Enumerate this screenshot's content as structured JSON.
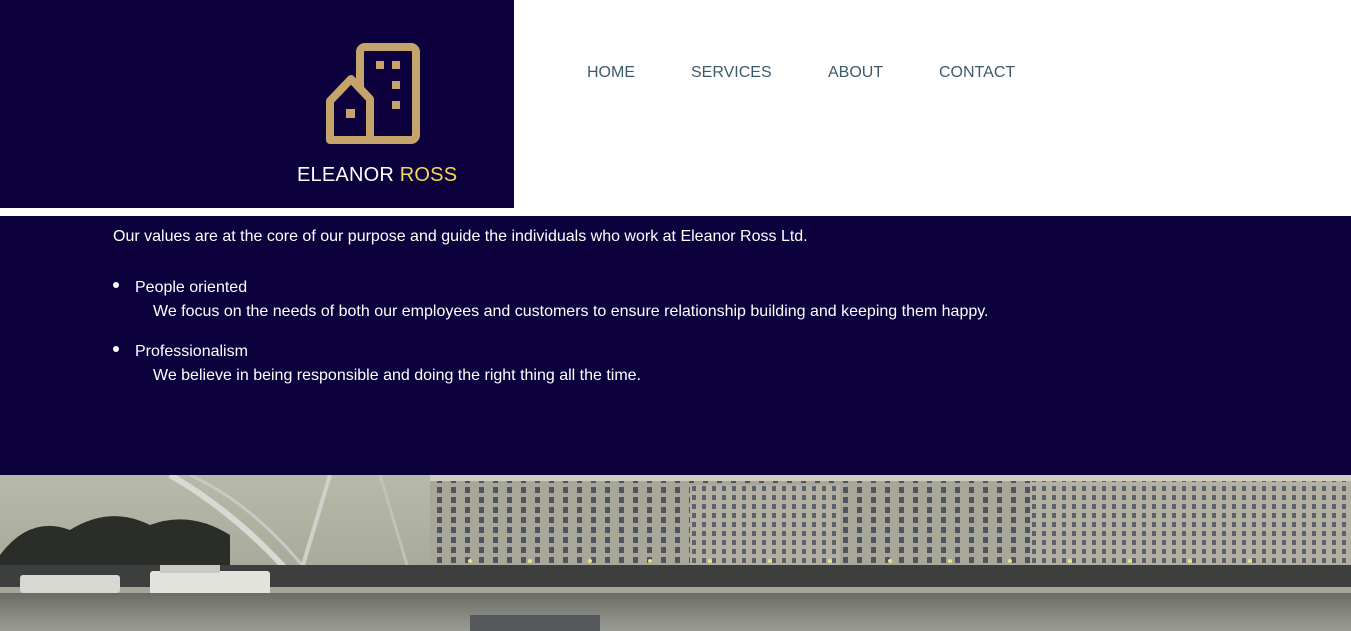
{
  "header": {
    "brand": {
      "first": "ELEANOR",
      "last": "ROSS",
      "icon": "building-icon"
    },
    "nav": [
      {
        "label": "HOME"
      },
      {
        "label": "SERVICES"
      },
      {
        "label": "ABOUT"
      },
      {
        "label": "CONTACT"
      }
    ]
  },
  "values": {
    "intro": "Our values are at the core of our purpose and guide the individuals who work at Eleanor Ross Ltd.",
    "items": [
      {
        "title": "People oriented",
        "description": "We focus on the needs of both our employees and customers to ensure relationship building and keeping them happy."
      },
      {
        "title": "Professionalism",
        "description": "We believe in being responsible and doing the right thing all the time."
      }
    ]
  },
  "colors": {
    "navy": "#0c013d",
    "gold": "#c4a46a",
    "accent_yellow": "#f5d75a",
    "nav_text": "#3d5a6c"
  }
}
